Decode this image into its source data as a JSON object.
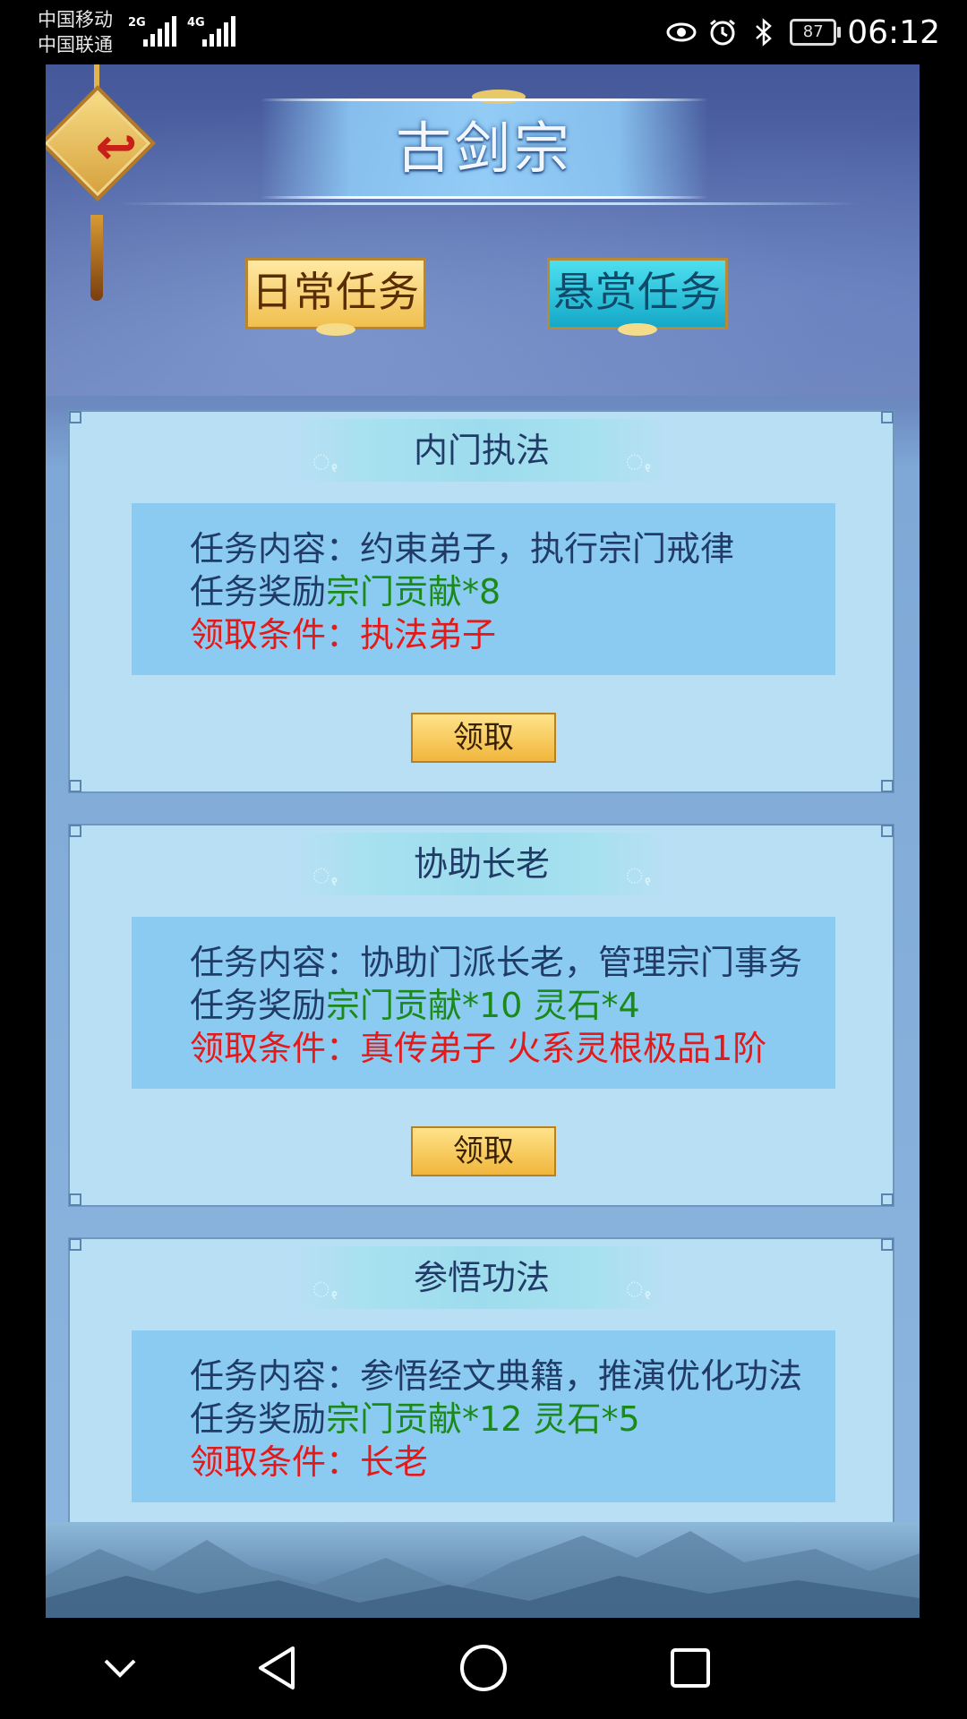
{
  "status_bar": {
    "carrier1": "中国移动",
    "carrier2": "中国联通",
    "signal1_type": "2G",
    "signal2_type": "4G",
    "battery": "87",
    "time": "06:12",
    "icons": [
      "eye-icon",
      "alarm-icon",
      "bluetooth-icon"
    ]
  },
  "header": {
    "title": "古剑宗",
    "back_icon": "return-arrow-icon",
    "tabs": [
      {
        "label": "日常任务",
        "active": false
      },
      {
        "label": "悬赏任务",
        "active": true
      }
    ]
  },
  "quests": [
    {
      "title": "内门执法",
      "content_label": "任务内容：",
      "content": "约束弟子，执行宗门戒律",
      "reward_label": "任务奖励",
      "reward": "宗门贡献*8",
      "condition_label": "领取条件：",
      "condition": "执法弟子",
      "button": "领取"
    },
    {
      "title": "协助长老",
      "content_label": "任务内容：",
      "content": "协助门派长老，管理宗门事务",
      "reward_label": "任务奖励",
      "reward": "宗门贡献*10 灵石*4",
      "condition_label": "领取条件：",
      "condition": "真传弟子 火系灵根极品1阶",
      "button": "领取"
    },
    {
      "title": "参悟功法",
      "content_label": "任务内容：",
      "content": "参悟经文典籍，推演优化功法",
      "reward_label": "任务奖励",
      "reward": "宗门贡献*12 灵石*5",
      "condition_label": "领取条件：",
      "condition": "长老"
    }
  ],
  "colors": {
    "reward": "#1b8a1b",
    "condition": "#e41a1a",
    "label": "#1f3b66",
    "card_bg": "#b9dff5",
    "info_box_bg": "#8ccbf1"
  },
  "nav": [
    "chevron-down-icon",
    "back-triangle-icon",
    "home-circle-icon",
    "recents-square-icon"
  ]
}
